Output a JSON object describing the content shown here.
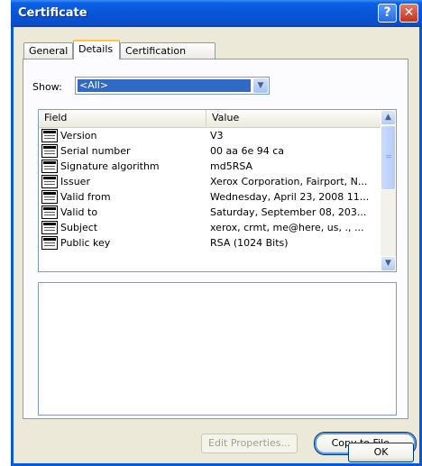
{
  "window": {
    "title": "Certificate",
    "help_glyph": "?",
    "close_glyph": "✕"
  },
  "tabs": [
    {
      "label": "General"
    },
    {
      "label": "Details"
    },
    {
      "label": "Certification Path"
    }
  ],
  "show": {
    "label": "Show:",
    "selected": "<All>",
    "dropdown_glyph": "▼"
  },
  "list": {
    "columns": [
      "Field",
      "Value"
    ],
    "rows": [
      {
        "field": "Version",
        "value": "V3"
      },
      {
        "field": "Serial number",
        "value": "00 aa 6e 94 ca"
      },
      {
        "field": "Signature algorithm",
        "value": "md5RSA"
      },
      {
        "field": "Issuer",
        "value": "Xerox Corporation, Fairport, N..."
      },
      {
        "field": "Valid from",
        "value": "Wednesday, April 23, 2008 11..."
      },
      {
        "field": "Valid to",
        "value": "Saturday, September 08, 203..."
      },
      {
        "field": "Subject",
        "value": "xerox, crmt, me@here, us, ., ..."
      },
      {
        "field": "Public key",
        "value": "RSA (1024 Bits)"
      }
    ],
    "scroll_up_glyph": "▲",
    "scroll_down_glyph": "▼"
  },
  "buttons": {
    "edit_properties": "Edit Properties...",
    "copy_to_file": "Copy to File...",
    "ok": "OK"
  },
  "colors": {
    "titlebar": "#0a58d8",
    "selection": "#316ac5",
    "dialog_face": "#ece9d8"
  }
}
